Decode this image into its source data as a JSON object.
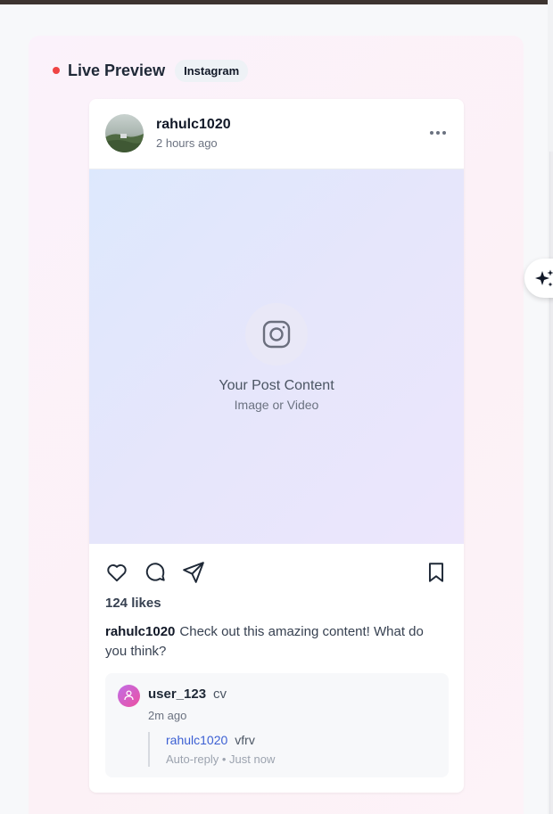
{
  "preview": {
    "title": "Live Preview",
    "platform": "Instagram",
    "live_dot_color": "#ef4444"
  },
  "post": {
    "username": "rahulc1020",
    "time_ago": "2 hours ago",
    "more_icon": "more-horizontal-icon",
    "media_title": "Your Post Content",
    "media_subtitle": "Image or Video",
    "media_icon": "instagram-icon",
    "likes": "124 likes",
    "caption_user": "rahulc1020",
    "caption_text": "Check out this amazing content! What do you think?",
    "actions": [
      "heart-icon",
      "comment-icon",
      "send-icon",
      "bookmark-icon"
    ]
  },
  "comments": [
    {
      "user": "user_123",
      "text": "cv",
      "time": "2m ago",
      "reply": {
        "user": "rahulc1020",
        "text": "vfrv",
        "meta": "Auto-reply • Just now"
      }
    }
  ],
  "assistant_button": {
    "icon": "sparkles-icon"
  }
}
